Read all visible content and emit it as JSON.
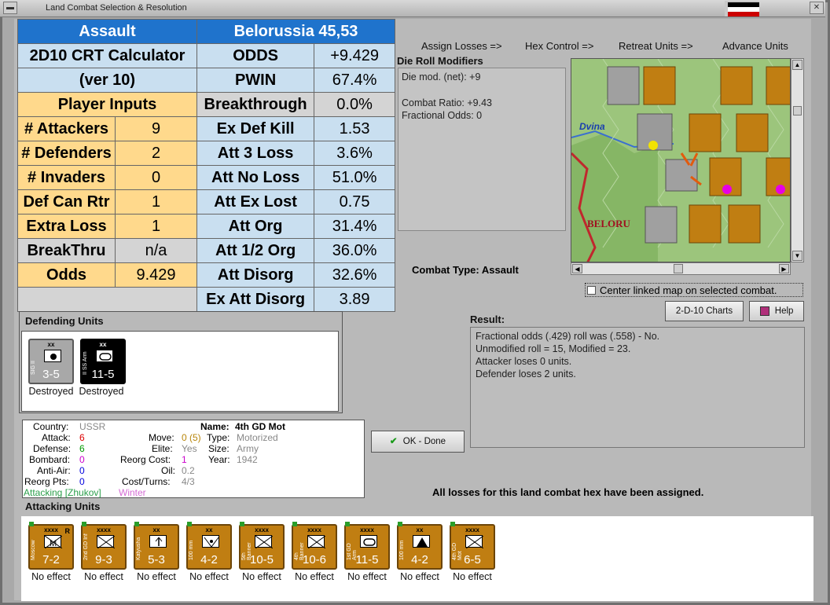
{
  "window": {
    "title": "Land Combat Selection & Resolution"
  },
  "crt": {
    "assault": "Assault",
    "hex": "Belorussia 45,53",
    "calc_title": "2D10 CRT Calculator",
    "calc_ver": "(ver 10)",
    "player_inputs": "Player Inputs",
    "odds_label": "ODDS",
    "odds_val": "+9.429",
    "pwin_label": "PWIN",
    "pwin_val": "67.4%",
    "rows": [
      {
        "l": "# Attackers",
        "v": "9",
        "r": "Breakthrough",
        "rv": "0.0%"
      },
      {
        "l": "# Defenders",
        "v": "2",
        "r": "Ex Def Kill",
        "rv": "1.53"
      },
      {
        "l": "# Invaders",
        "v": "0",
        "r": "Att 3 Loss",
        "rv": "3.6%"
      },
      {
        "l": "Def Can Rtr",
        "v": "1",
        "r": "Att No Loss",
        "rv": "51.0%"
      },
      {
        "l": "Extra Loss",
        "v": "1",
        "r": "Att Ex Lost",
        "rv": "0.75"
      },
      {
        "l": "BreakThru",
        "v": "n/a",
        "r": "Att Org",
        "rv": "31.4%"
      },
      {
        "l": "Odds",
        "v": "9.429",
        "r": "Att 1/2 Org",
        "rv": "36.0%"
      },
      {
        "l": "",
        "v": "",
        "r": "Att Disorg",
        "rv": "32.6%"
      },
      {
        "l": "",
        "v": "",
        "r": "Ex Att Disorg",
        "rv": "3.89"
      }
    ]
  },
  "phases": [
    "Assign Losses =>",
    "Hex Control =>",
    "Retreat Units =>",
    "Advance Units"
  ],
  "modifiers": {
    "title": "Die Roll Modifiers",
    "lines": [
      "Die mod. (net): +9",
      "",
      "Combat Ratio: +9.43",
      "Fractional Odds: 0"
    ]
  },
  "combat_type": {
    "label": "Combat Type:",
    "value": "Assault"
  },
  "center_map_label": "Center linked map on selected combat.",
  "buttons": {
    "charts": "2-D-10 Charts",
    "help": "Help",
    "ok": "OK - Done"
  },
  "result": {
    "label": "Result:",
    "lines": [
      "Fractional odds (.429) roll was (.558)  - No.",
      "Unmodified roll = 15, Modified = 23.",
      "Attacker loses 0 units.",
      "Defender loses 2 units."
    ]
  },
  "defending": {
    "label": "Defending Units",
    "units": [
      {
        "size": "xx",
        "name": "SIG II",
        "str": "3-5",
        "effect": "Destroyed",
        "color": "#a8a8a8"
      },
      {
        "size": "xx",
        "name": "II SS Arm",
        "str": "11-5",
        "effect": "Destroyed",
        "color": "#000000"
      }
    ]
  },
  "unit_info": {
    "country_l": "Country:",
    "country": "USSR",
    "attack_l": "Attack:",
    "attack": "6",
    "defense_l": "Defense:",
    "defense": "6",
    "bombard_l": "Bombard:",
    "bombard": "0",
    "antiair_l": "Anti-Air:",
    "antiair": "0",
    "reorg_l": "Reorg Pts:",
    "reorg": "0",
    "name_l": "Name:",
    "name": "4th GD Mot",
    "move_l": "Move:",
    "move": "0 (5)",
    "type_l": "Type:",
    "type": "Motorized",
    "elite_l": "Elite:",
    "elite": "Yes",
    "size_l": "Size:",
    "size": "Army",
    "rcost_l": "Reorg Cost:",
    "rcost": "1",
    "year_l": "Year:",
    "year": "1942",
    "oil_l": "Oil:",
    "oil": "0.2",
    "cost_l": "Cost/Turns:",
    "cost": "4/3",
    "attacking": "Attacking [Zhukov]",
    "season": "Winter"
  },
  "all_losses": "All losses for this land combat hex have been assigned.",
  "attacking": {
    "label": "Attacking Units",
    "units": [
      {
        "size": "xxxx",
        "name": "Moscow",
        "str": "7-2",
        "effect": "No effect",
        "r": "R",
        "sym": "mech"
      },
      {
        "size": "xxxx",
        "name": "2nd GD Inf",
        "str": "9-3",
        "effect": "No effect",
        "r": "",
        "sym": "inf"
      },
      {
        "size": "xx",
        "name": "Katyusha",
        "str": "5-3",
        "effect": "No effect",
        "r": "",
        "sym": "rocket"
      },
      {
        "size": "xx",
        "name": "100 mm",
        "str": "4-2",
        "effect": "No effect",
        "r": "",
        "sym": "aa"
      },
      {
        "size": "xxxx",
        "name": "5th Banner",
        "str": "10-5",
        "effect": "No effect",
        "r": "",
        "sym": "inf"
      },
      {
        "size": "xxxx",
        "name": "4th Banner",
        "str": "10-6",
        "effect": "No effect",
        "r": "",
        "sym": "inf"
      },
      {
        "size": "xxxx",
        "name": "1st GD Arm",
        "str": "11-5",
        "effect": "No effect",
        "r": "",
        "sym": "arm"
      },
      {
        "size": "xx",
        "name": "100 mm",
        "str": "4-2",
        "effect": "No effect",
        "r": "",
        "sym": "art"
      },
      {
        "size": "xxxx",
        "name": "4th GD Mot",
        "str": "6-5",
        "effect": "No effect",
        "r": "",
        "sym": "inf"
      }
    ]
  },
  "map": {
    "label1": "Dvina",
    "label2": "BELORU"
  }
}
